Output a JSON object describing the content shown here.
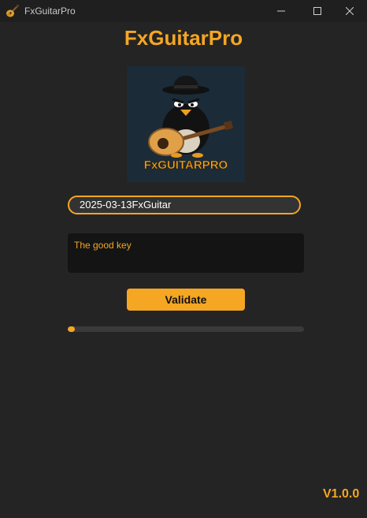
{
  "window": {
    "title": "FxGuitarPro",
    "icon": "guitar-icon",
    "controls": [
      "minimize-icon",
      "maximize-icon",
      "close-icon"
    ]
  },
  "app": {
    "heading": "FxGuitarPro",
    "logo_text": "FxGUITARPRO",
    "key_input_value": "2025-03-13FxGuitar",
    "status_message": "The good key",
    "validate_label": "Validate",
    "progress_fraction": 0.03,
    "version": "V1.0.0"
  },
  "colors": {
    "accent": "#f5a623",
    "background": "#242424",
    "titlebar": "#1f1f1f",
    "status_bg": "#141414",
    "logo_bg": "#1b2b38"
  }
}
